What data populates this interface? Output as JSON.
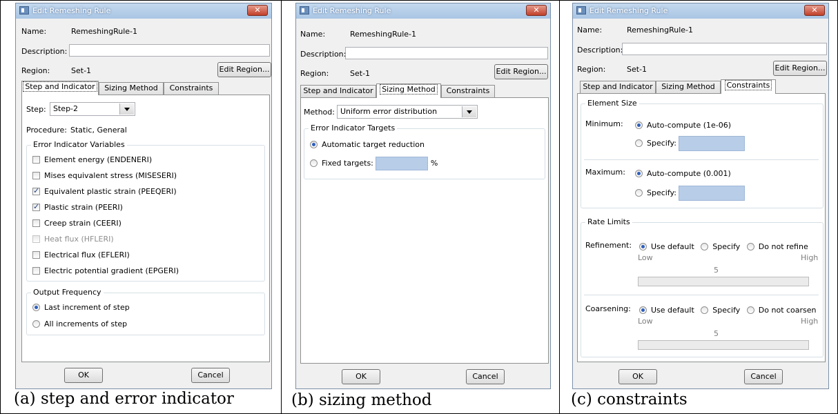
{
  "dialog_title": "Edit Remeshing Rule",
  "close_glyph": "✕",
  "name_label": "Name:",
  "name_value": "RemeshingRule-1",
  "description_label": "Description:",
  "region_label": "Region:",
  "region_value": "Set-1",
  "edit_region_button": "Edit Region...",
  "tabs": [
    "Step and Indicator",
    "Sizing Method",
    "Constraints"
  ],
  "ok_button": "OK",
  "cancel_button": "Cancel",
  "captions": [
    "(a) step and error indicator",
    "(b) sizing method",
    "(c) constraints"
  ],
  "panel_a": {
    "step_label": "Step:",
    "step_value": "Step-2",
    "procedure_label": "Procedure:",
    "procedure_value": "Static, General",
    "error_group": "Error Indicator Variables",
    "variables": [
      {
        "label": "Element energy (ENDENERI)",
        "checked": false,
        "enabled": true
      },
      {
        "label": "Mises equivalent stress (MISESERI)",
        "checked": false,
        "enabled": true
      },
      {
        "label": "Equivalent plastic strain (PEEQERI)",
        "checked": true,
        "enabled": true
      },
      {
        "label": "Plastic strain (PEERI)",
        "checked": true,
        "enabled": true
      },
      {
        "label": "Creep strain (CEERI)",
        "checked": false,
        "enabled": true
      },
      {
        "label": "Heat flux (HFLERI)",
        "checked": false,
        "enabled": false
      },
      {
        "label": "Electrical flux (EFLERI)",
        "checked": false,
        "enabled": true
      },
      {
        "label": "Electric potential gradient (EPGERI)",
        "checked": false,
        "enabled": true
      }
    ],
    "output_group": "Output Frequency",
    "output_options": [
      "Last increment of step",
      "All increments of step"
    ],
    "output_selected": 0
  },
  "panel_b": {
    "method_label": "Method:",
    "method_value": "Uniform error distribution",
    "targets_group": "Error Indicator Targets",
    "auto_target": "Automatic target reduction",
    "fixed_targets": "Fixed targets:",
    "percent": "%"
  },
  "panel_c": {
    "element_size_group": "Element Size",
    "minimum_label": "Minimum:",
    "minimum_auto": "Auto-compute (1e-06)",
    "maximum_label": "Maximum:",
    "maximum_auto": "Auto-compute (0.001)",
    "specify_label": "Specify:",
    "rate_group": "Rate Limits",
    "refinement_label": "Refinement:",
    "coarsening_label": "Coarsening:",
    "use_default": "Use default",
    "specify": "Specify",
    "do_not_refine": "Do not refine",
    "do_not_coarsen": "Do not coarsen",
    "low": "Low",
    "high": "High",
    "refinement_value": "5",
    "coarsening_value": "5"
  }
}
